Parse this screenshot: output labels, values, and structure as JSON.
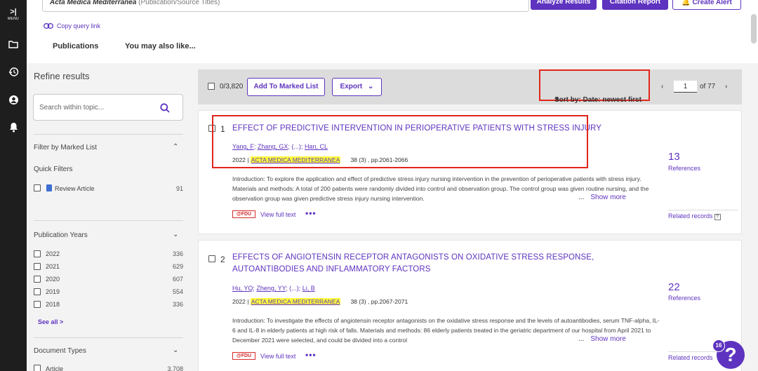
{
  "rail": {
    "menu_label": "MENU"
  },
  "search": {
    "query_value": "Acta Medica Mediterranea",
    "query_field": "(Publication/Source Titles)"
  },
  "actions": {
    "analyze": "Analyze Results",
    "citation": "Citation Report",
    "alert": "Create Alert"
  },
  "copy_query": "Copy query link",
  "tabs": [
    "Publications",
    "You may also like..."
  ],
  "sidebar": {
    "title": "Refine results",
    "search_placeholder": "Search within topic...",
    "marked_list": "Filter by Marked List",
    "quick_filters": {
      "title": "Quick Filters",
      "items": [
        {
          "label": "Review Article",
          "count": "91"
        }
      ]
    },
    "years": {
      "title": "Publication Years",
      "items": [
        {
          "label": "2022",
          "count": "336"
        },
        {
          "label": "2021",
          "count": "629"
        },
        {
          "label": "2020",
          "count": "607"
        },
        {
          "label": "2019",
          "count": "554"
        },
        {
          "label": "2018",
          "count": "336"
        }
      ],
      "see_all": "See all >"
    },
    "doc_types": {
      "title": "Document Types",
      "items": [
        {
          "label": "Article",
          "count": "3,708"
        }
      ]
    }
  },
  "toolbar": {
    "selected": "0/3,820",
    "add_marked": "Add To Marked List",
    "export": "Export",
    "sort": "Sort by: Date: newest first",
    "page": "1",
    "of_pages": "of 77"
  },
  "results": [
    {
      "num": "1",
      "title": "EFFECT OF PREDICTIVE INTERVENTION IN PERIOPERATIVE PATIENTS WITH STRESS INJURY",
      "authors": [
        "Yang, F",
        "Zhang, GX",
        "(...)",
        "Han, CL"
      ],
      "year": "2022",
      "journal": "ACTA MEDICA MEDITERRANEA",
      "vol": "38 (3) , pp.2061-2066",
      "abstract": "Introduction: To explore the application and effect of predictive stress injury nursing intervention in the prevention of perioperative patients with stress injury. Materials and methods: A total of 200 patients were randomly divided into control and observation group. The control group was given routine nursing, and the observation group was given predictive stress injury nursing intervention.",
      "show_more": "Show more",
      "fdu": "@FDU",
      "full_text": "View full text",
      "refs": "13",
      "refs_label": "References",
      "related": "Related records"
    },
    {
      "num": "2",
      "title": "EFFECTS OF ANGIOTENSIN RECEPTOR ANTAGONISTS ON OXIDATIVE STRESS RESPONSE, AUTOANTIBODIES AND INFLAMMATORY FACTORS",
      "authors": [
        "Hu, YQ",
        "Zheng, YY",
        "(...)",
        "Li, B"
      ],
      "year": "2022",
      "journal": "ACTA MEDICA MEDITERRANEA",
      "vol": "38 (3) , pp.2067-2071",
      "abstract": "Introduction: To investigate the effects of angiotensin receptor antagonists on the oxidative stress response and the levels of autoantibodies, serum TNF-alpha, IL-6 and IL-8 in elderly patients at high risk of falls. Materials and methods: 86 elderly patients treated in the geriatric department of our hospital from April 2021 to December 2021 were selected, and could be divided into a control",
      "show_more": "Show more",
      "fdu": "@FDU",
      "full_text": "View full text",
      "refs": "22",
      "refs_label": "References",
      "related": "Related records"
    }
  ],
  "help": {
    "badge": "16",
    "glyph": "?"
  },
  "colors": {
    "accent": "#5e33bf",
    "highlight": "#ffff3a",
    "annotation": "#e1251b"
  }
}
